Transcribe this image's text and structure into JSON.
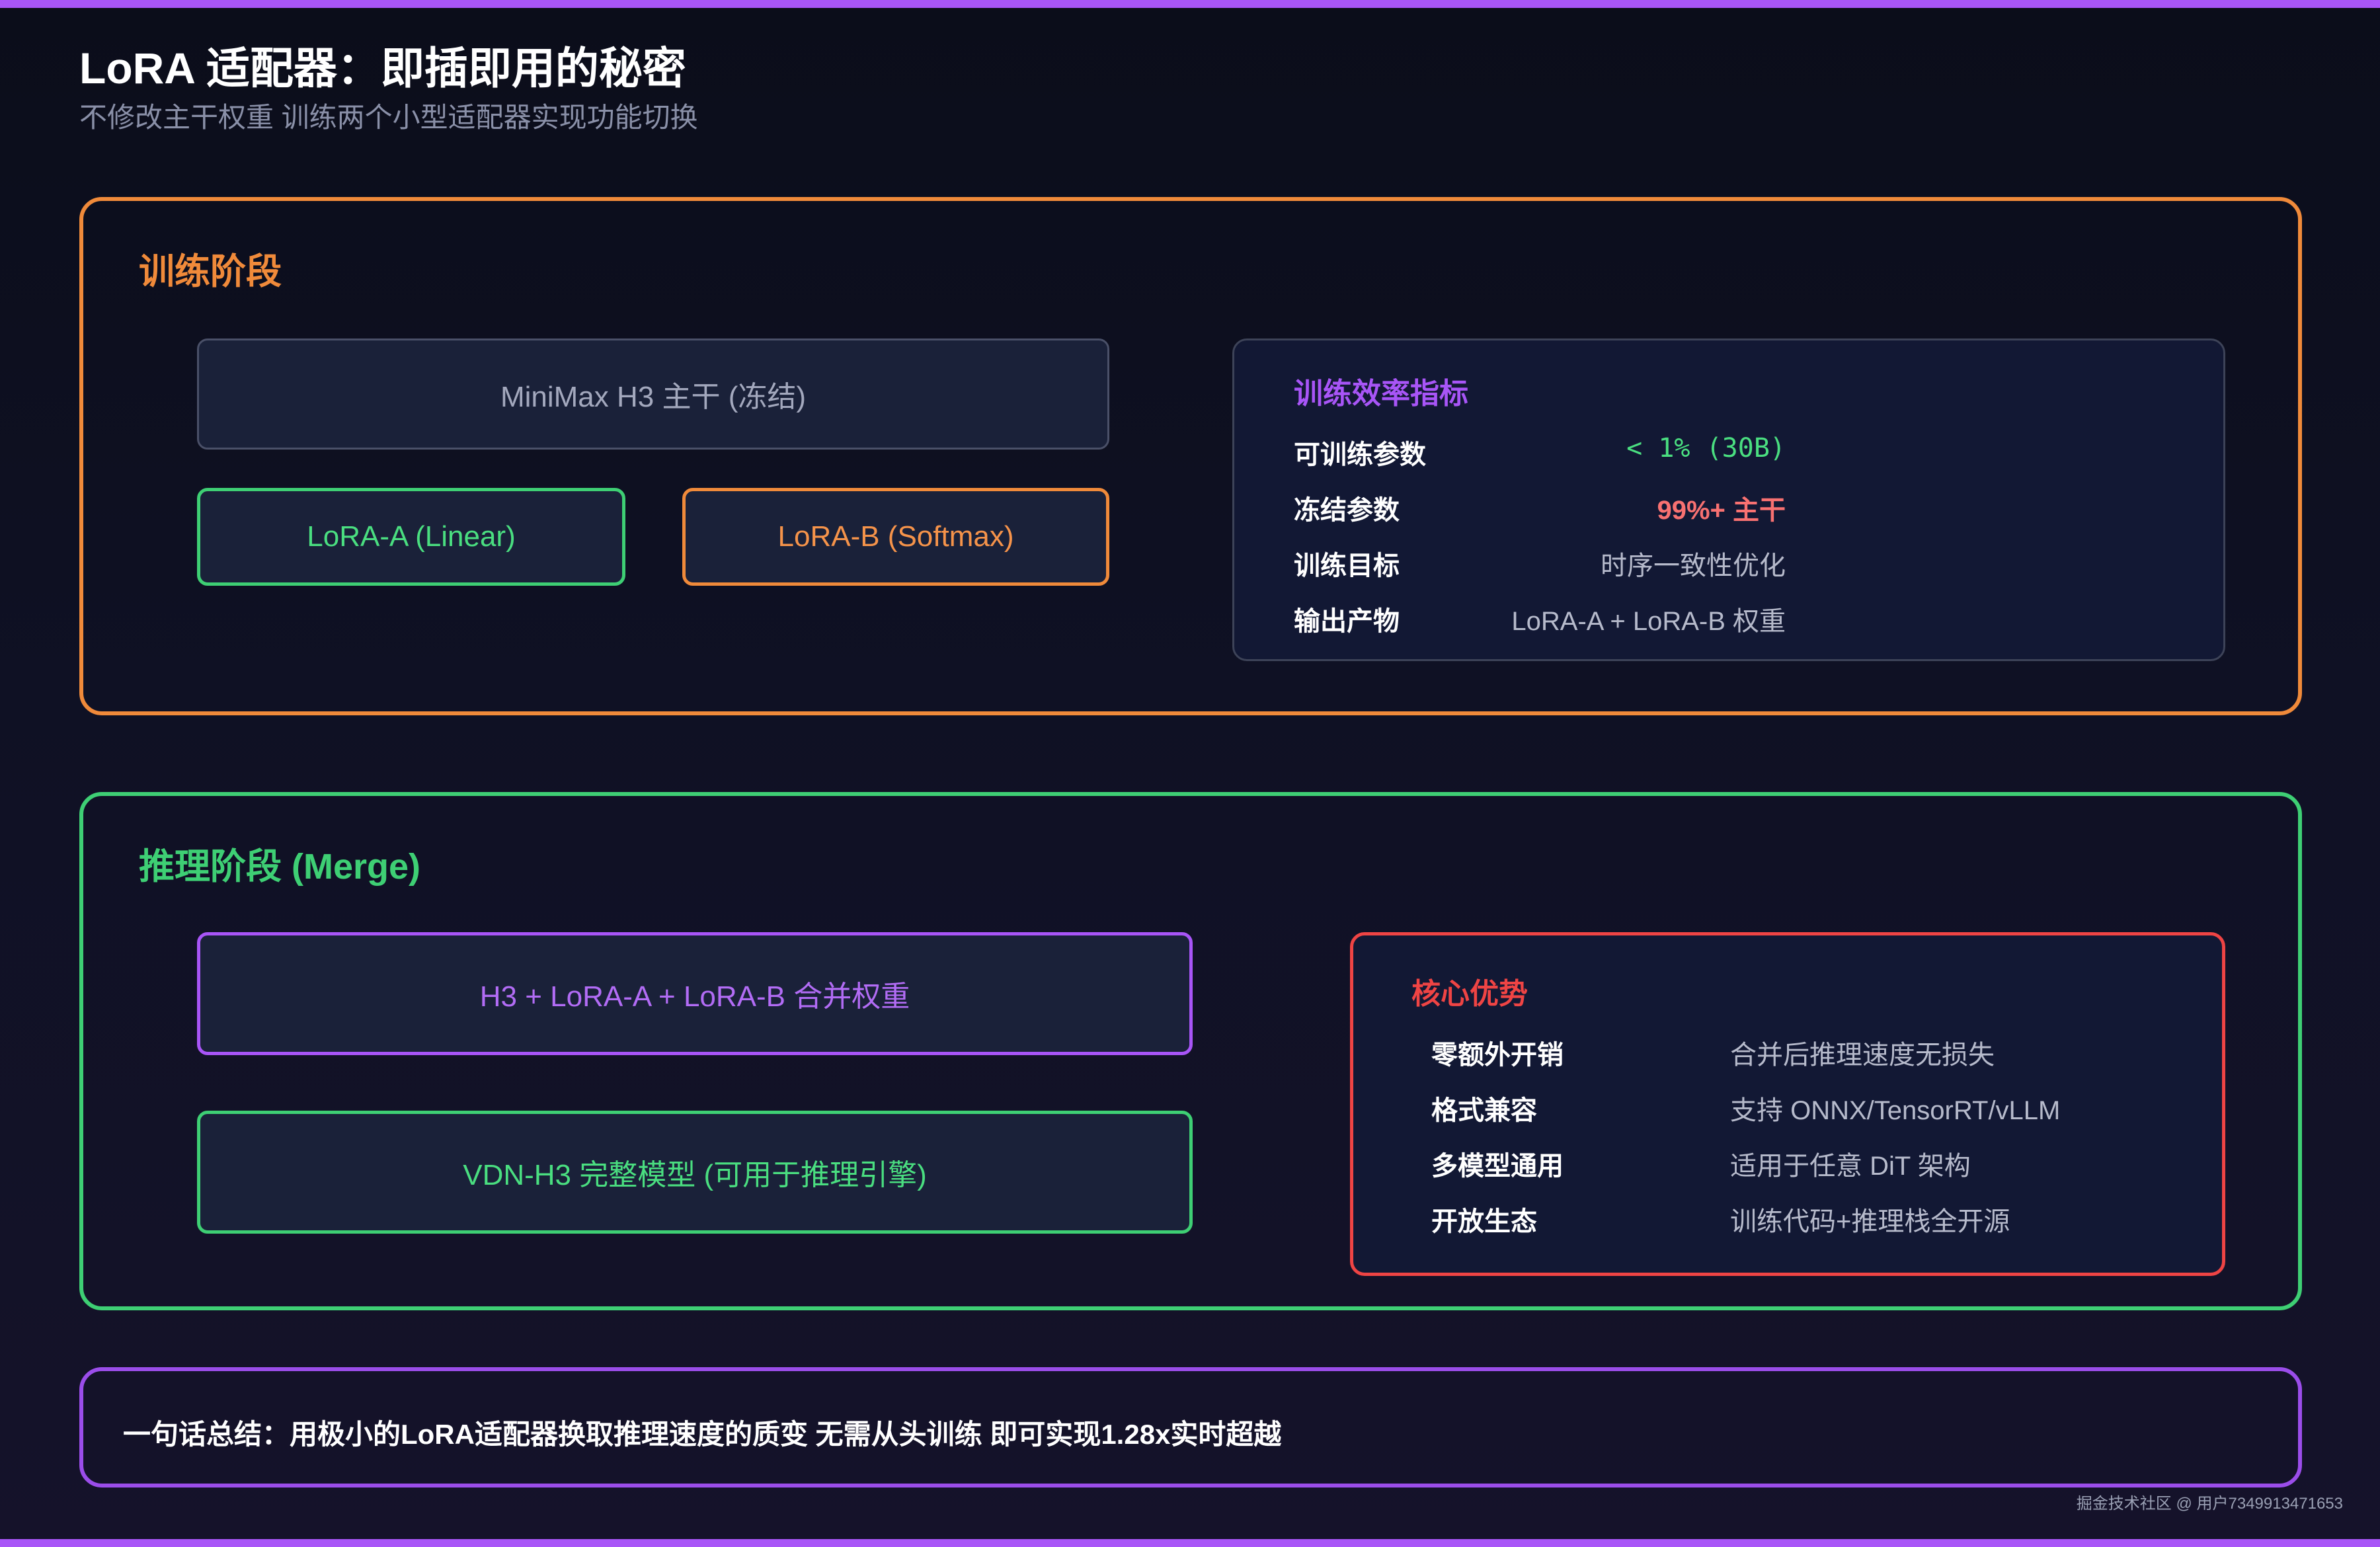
{
  "header": {
    "title": "LoRA 适配器：即插即用的秘密",
    "subtitle": "不修改主干权重 训练两个小型适配器实现功能切换"
  },
  "training": {
    "heading": "训练阶段",
    "backbone": "MiniMax H3 主干 (冻结)",
    "lora_a": "LoRA-A (Linear)",
    "lora_b": "LoRA-B (Softmax)",
    "metrics": {
      "title": "训练效率指标",
      "rows": [
        {
          "label": "可训练参数",
          "value": "< 1% (30B)"
        },
        {
          "label": "冻结参数",
          "value": "99%+ 主干"
        },
        {
          "label": "训练目标",
          "value": "时序一致性优化"
        },
        {
          "label": "输出产物",
          "value": "LoRA-A + LoRA-B 权重"
        }
      ]
    }
  },
  "inference": {
    "heading": "推理阶段 (Merge)",
    "merge_box": "H3 + LoRA-A + LoRA-B 合并权重",
    "model_box": "VDN-H3 完整模型 (可用于推理引擎)",
    "advantages": {
      "title": "核心优势",
      "rows": [
        {
          "label": "零额外开销",
          "value": "合并后推理速度无损失"
        },
        {
          "label": "格式兼容",
          "value": "支持 ONNX/TensorRT/vLLM"
        },
        {
          "label": "多模型通用",
          "value": "适用于任意 DiT 架构"
        },
        {
          "label": "开放生态",
          "value": "训练代码+推理栈全开源"
        }
      ]
    }
  },
  "summary": {
    "text": "一句话总结：用极小的LoRA适配器换取推理速度的质变 无需从头训练 即可实现1.28x实时超越"
  },
  "watermark": "掘金技术社区 @ 用户7349913471653",
  "colors": {
    "accent_purple": "#a855f7",
    "training_orange": "#f08a3a",
    "inference_green": "#3ecf74",
    "advantage_red": "#ef4444",
    "metric_green": "#4ade80",
    "metric_red": "#f87171"
  }
}
